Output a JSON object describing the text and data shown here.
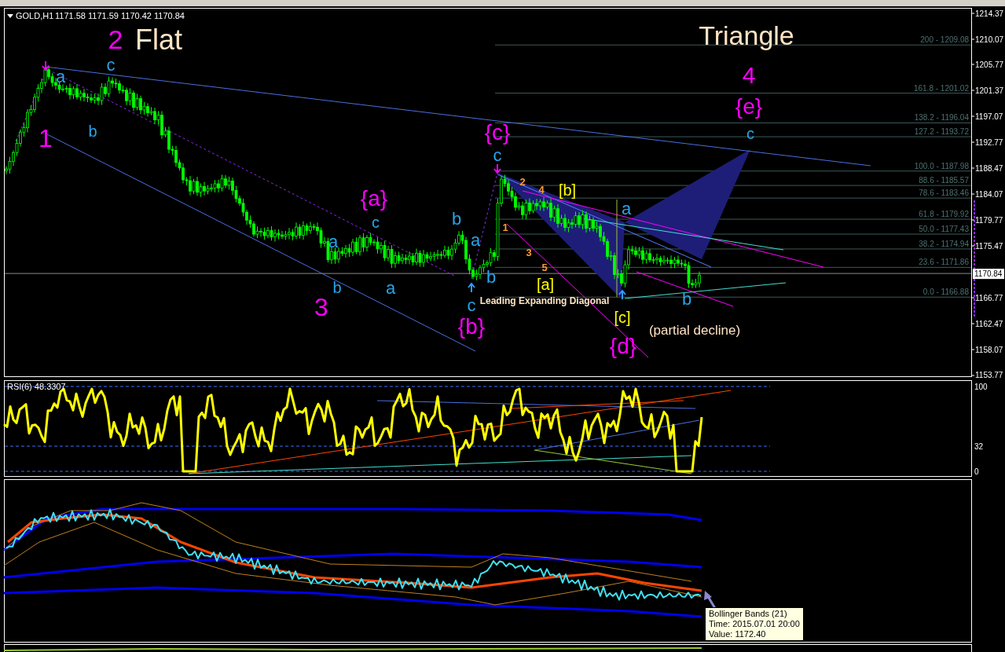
{
  "chart": {
    "symbol": "GOLD,H1",
    "quote": "1171.58 1171.59 1170.42 1170.84"
  },
  "price_axis": {
    "labels": [
      "1214.37",
      "1210.07",
      "1205.77",
      "1201.37",
      "1197.07",
      "1192.77",
      "1188.47",
      "1184.07",
      "1179.77",
      "1175.47",
      "1166.77",
      "1162.47",
      "1158.07",
      "1153.77"
    ],
    "current": "1170.84"
  },
  "fibonacci": {
    "levels": [
      {
        "label": "200 - 1209.08"
      },
      {
        "label": "161.8 - 1201.02"
      },
      {
        "label": "138.2 - 1196.04"
      },
      {
        "label": "127.2 - 1193.72"
      },
      {
        "label": "100.0 - 1187.98"
      },
      {
        "label": "88.6 - 1185.57"
      },
      {
        "label": "78.6 - 1183.46"
      },
      {
        "label": "61.8 - 1179.92"
      },
      {
        "label": "50.0 - 1177.43"
      },
      {
        "label": "38.2 - 1174.94"
      },
      {
        "label": "23.6 - 1171.86"
      },
      {
        "label": "0.0 - 1166.88"
      }
    ]
  },
  "wave_labels": [
    {
      "text": "2",
      "color": "#ff00ff"
    },
    {
      "text": "Flat",
      "color": "#ffe4c4"
    },
    {
      "text": "Triangle",
      "color": "#ffe4c4"
    },
    {
      "text": "a",
      "color": "#27a4e8"
    },
    {
      "text": "c",
      "color": "#27a4e8"
    },
    {
      "text": "4",
      "color": "#ff00ff"
    },
    {
      "text": "{e}",
      "color": "#ff00ff"
    },
    {
      "text": "1",
      "color": "#ff00ff"
    },
    {
      "text": "b",
      "color": "#27a4e8"
    },
    {
      "text": "{c}",
      "color": "#ff00ff"
    },
    {
      "text": "c",
      "color": "#27a4e8"
    },
    {
      "text": "c",
      "color": "#27a4e8"
    },
    {
      "text": "2",
      "color": "#ff9a2e"
    },
    {
      "text": "{a}",
      "color": "#ff00ff"
    },
    {
      "text": "4",
      "color": "#ff9a2e"
    },
    {
      "text": "[b]",
      "color": "#ffff00"
    },
    {
      "text": "a",
      "color": "#27a4e8"
    },
    {
      "text": "c",
      "color": "#27a4e8"
    },
    {
      "text": "b",
      "color": "#27a4e8"
    },
    {
      "text": "1",
      "color": "#ff9a2e"
    },
    {
      "text": "a",
      "color": "#27a4e8"
    },
    {
      "text": "a",
      "color": "#27a4e8"
    },
    {
      "text": "3",
      "color": "#ff9a2e"
    },
    {
      "text": "5",
      "color": "#ff9a2e"
    },
    {
      "text": "b",
      "color": "#27a4e8"
    },
    {
      "text": "a",
      "color": "#27a4e8"
    },
    {
      "text": "b",
      "color": "#27a4e8"
    },
    {
      "text": "[a]",
      "color": "#ffff00"
    },
    {
      "text": "3",
      "color": "#ff00ff"
    },
    {
      "text": "c",
      "color": "#27a4e8"
    },
    {
      "text": "Leading Expanding Diagonal",
      "color": "#ffe4c4"
    },
    {
      "text": "b",
      "color": "#27a4e8"
    },
    {
      "text": "[c]",
      "color": "#ffff00"
    },
    {
      "text": "{b}",
      "color": "#ff00ff"
    },
    {
      "text": "(partial decline)",
      "color": "#ffe4c4"
    },
    {
      "text": "{d}",
      "color": "#ff00ff"
    }
  ],
  "rsi": {
    "label": "RSI(6) 48.3307",
    "axis": [
      "100",
      "32",
      "0"
    ]
  },
  "bands_tooltip": {
    "lines": [
      "Bollinger Bands (21)",
      "Time: 2015.07.01 20:00",
      "Value: 1172.40"
    ]
  }
}
